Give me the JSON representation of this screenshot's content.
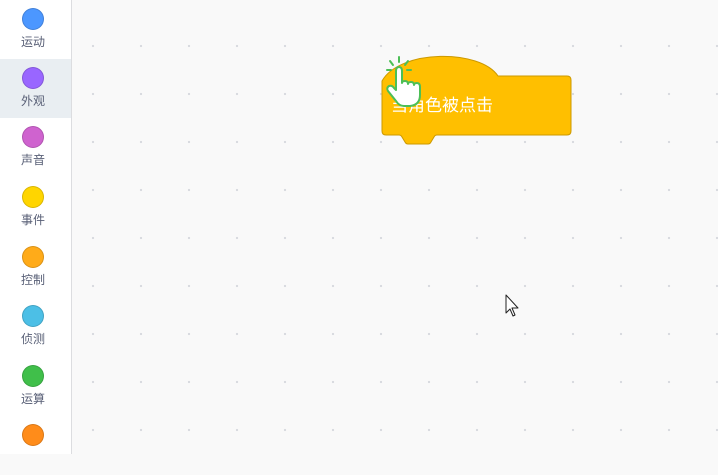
{
  "categories": [
    {
      "label": "运动",
      "color": "#4c97ff"
    },
    {
      "label": "外观",
      "color": "#9966ff"
    },
    {
      "label": "声音",
      "color": "#cf63cf"
    },
    {
      "label": "事件",
      "color": "#ffd500"
    },
    {
      "label": "控制",
      "color": "#ffab19"
    },
    {
      "label": "侦测",
      "color": "#4cbfe6"
    },
    {
      "label": "运算",
      "color": "#40bf4a"
    },
    {
      "label": "",
      "color": "#ff8c1a"
    }
  ],
  "selected_category": "外观",
  "block": {
    "text": "当角色被点击",
    "fill": "#ffbf00",
    "border": "#cc9900",
    "icon": "hand-pointer-click-icon"
  }
}
